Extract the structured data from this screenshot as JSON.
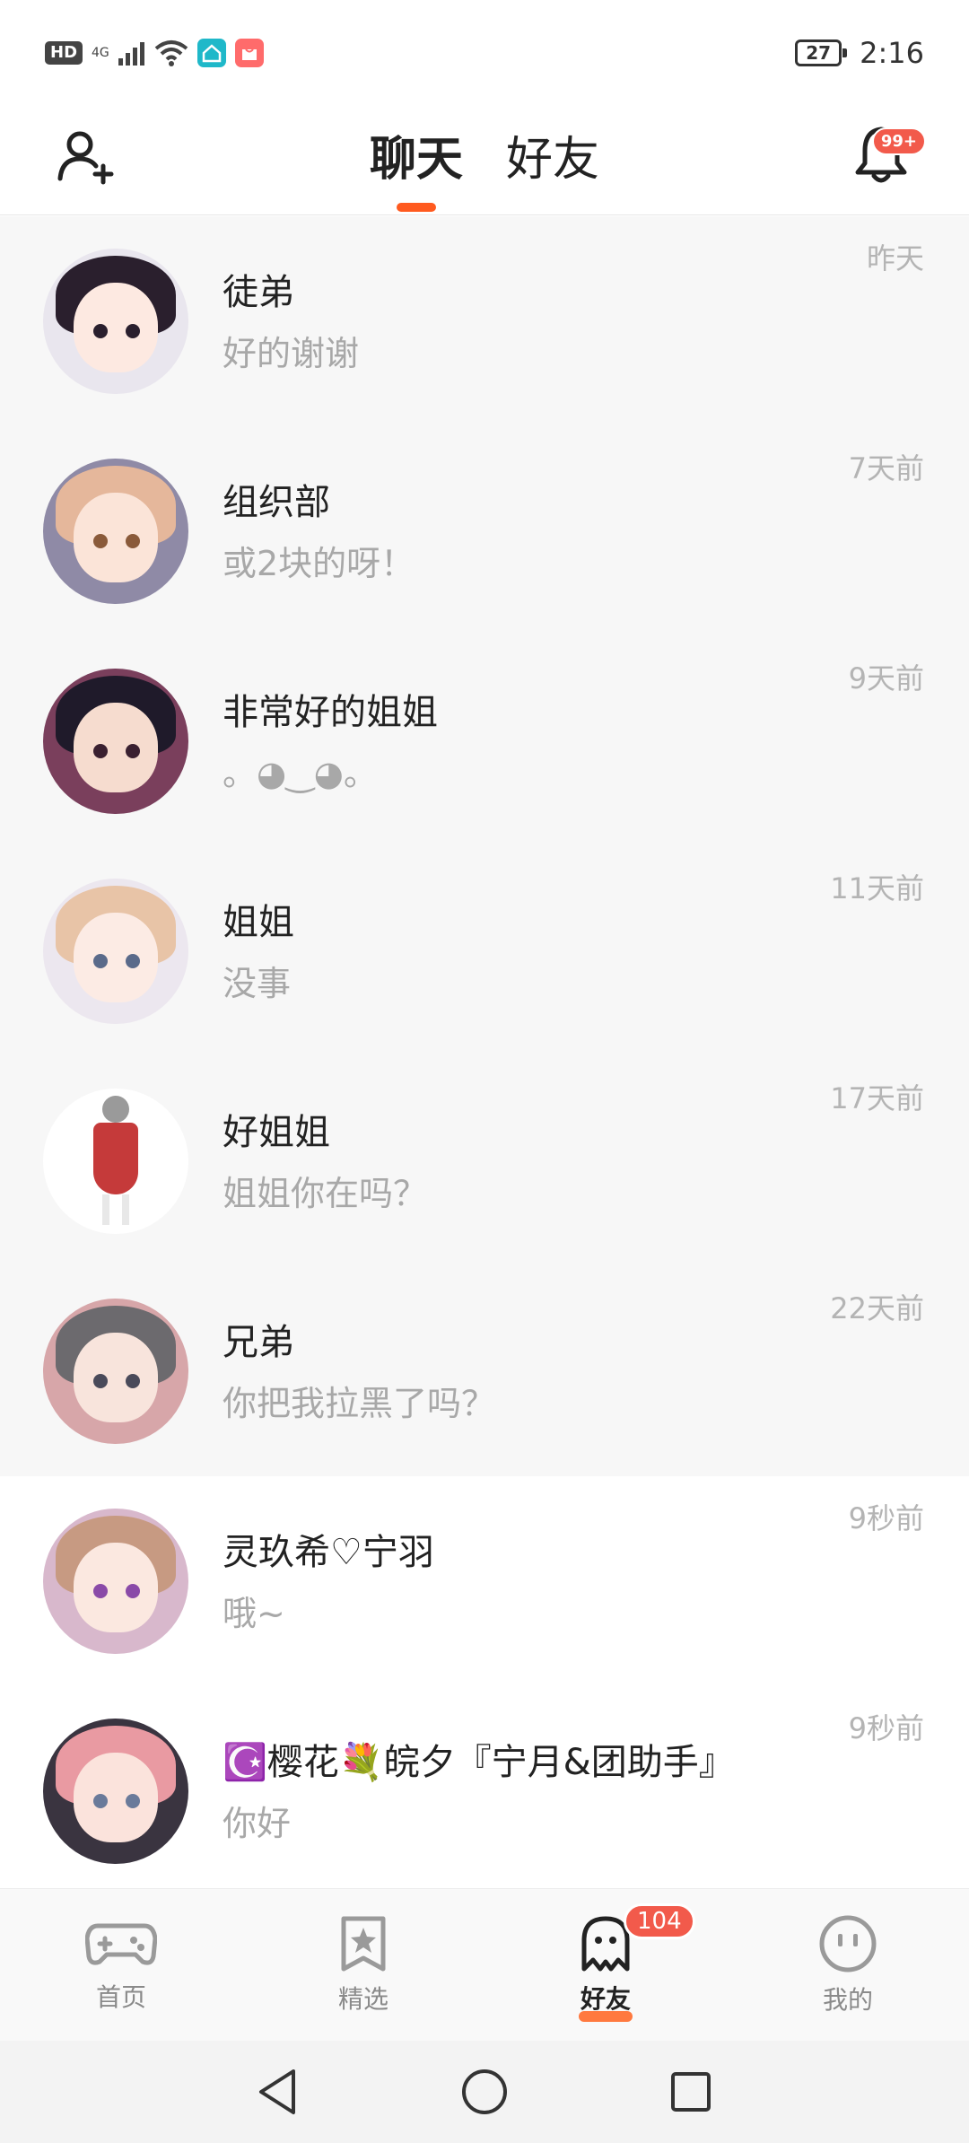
{
  "status_bar": {
    "hd": "HD",
    "network": "4G",
    "battery": "27",
    "time": "2:16"
  },
  "header": {
    "tabs": [
      {
        "label": "聊天",
        "active": true
      },
      {
        "label": "好友",
        "active": false
      }
    ],
    "notification_badge": "99+"
  },
  "chats": [
    {
      "name": "徒弟",
      "message": "好的谢谢",
      "time": "昨天",
      "avatar_colors": {
        "bg": "#e9e6ee",
        "hair": "#2a1f2d",
        "skin": "#fde9e1",
        "eye": "#2a1f2d"
      }
    },
    {
      "name": "组织部",
      "message": "或2块的呀！",
      "time": "7天前",
      "avatar_colors": {
        "bg": "#8f8aa6",
        "hair": "#e5b79b",
        "skin": "#fbe4d8",
        "eye": "#8a5a3a"
      }
    },
    {
      "name": "非常好的姐姐",
      "message": "。◕‿◕。",
      "time": "9天前",
      "avatar_colors": {
        "bg": "#7a3f5c",
        "hair": "#1f1a2a",
        "skin": "#f6dccf",
        "eye": "#3a2030"
      }
    },
    {
      "name": "姐姐",
      "message": "没事",
      "time": "11天前",
      "avatar_colors": {
        "bg": "#ece7ef",
        "hair": "#e8c4a7",
        "skin": "#fcebe4",
        "eye": "#5a6a8a"
      }
    },
    {
      "name": "好姐姐",
      "message": "姐姐你在吗？",
      "time": "17天前",
      "avatar_colors": {
        "bg": "#ffffff",
        "hair": "#9a9a9a",
        "skin": "#f5e6e0",
        "eye": "#c53a3a"
      }
    },
    {
      "name": "兄弟",
      "message": "你把我拉黑了吗？",
      "time": "22天前",
      "avatar_colors": {
        "bg": "#d7a6a9",
        "hair": "#6c6a6e",
        "skin": "#f8e4dc",
        "eye": "#4a4a5a"
      }
    },
    {
      "name": "灵玖希♡宁羽",
      "message": "哦~",
      "time": "9秒前",
      "avatar_colors": {
        "bg": "#d8b8cc",
        "hair": "#c79a82",
        "skin": "#fbe8e0",
        "eye": "#8a4aa8"
      }
    },
    {
      "name": "☪️樱花💐皖夕『宁月&团助手』",
      "message": "你好",
      "time": "9秒前",
      "avatar_colors": {
        "bg": "#3a3440",
        "hair": "#e99aa2",
        "skin": "#fbe3dc",
        "eye": "#6a7a9a"
      }
    }
  ],
  "bottom_tabs": [
    {
      "label": "首页",
      "icon": "gamepad-icon",
      "active": false
    },
    {
      "label": "精选",
      "icon": "star-bookmark-icon",
      "active": false
    },
    {
      "label": "好友",
      "icon": "ghost-icon",
      "active": true,
      "badge": "104"
    },
    {
      "label": "我的",
      "icon": "smiley-face-icon",
      "active": false
    }
  ],
  "colors": {
    "accent": "#ff5a1f",
    "badge": "#f25a4b",
    "muted_text": "#a8a8a8"
  }
}
